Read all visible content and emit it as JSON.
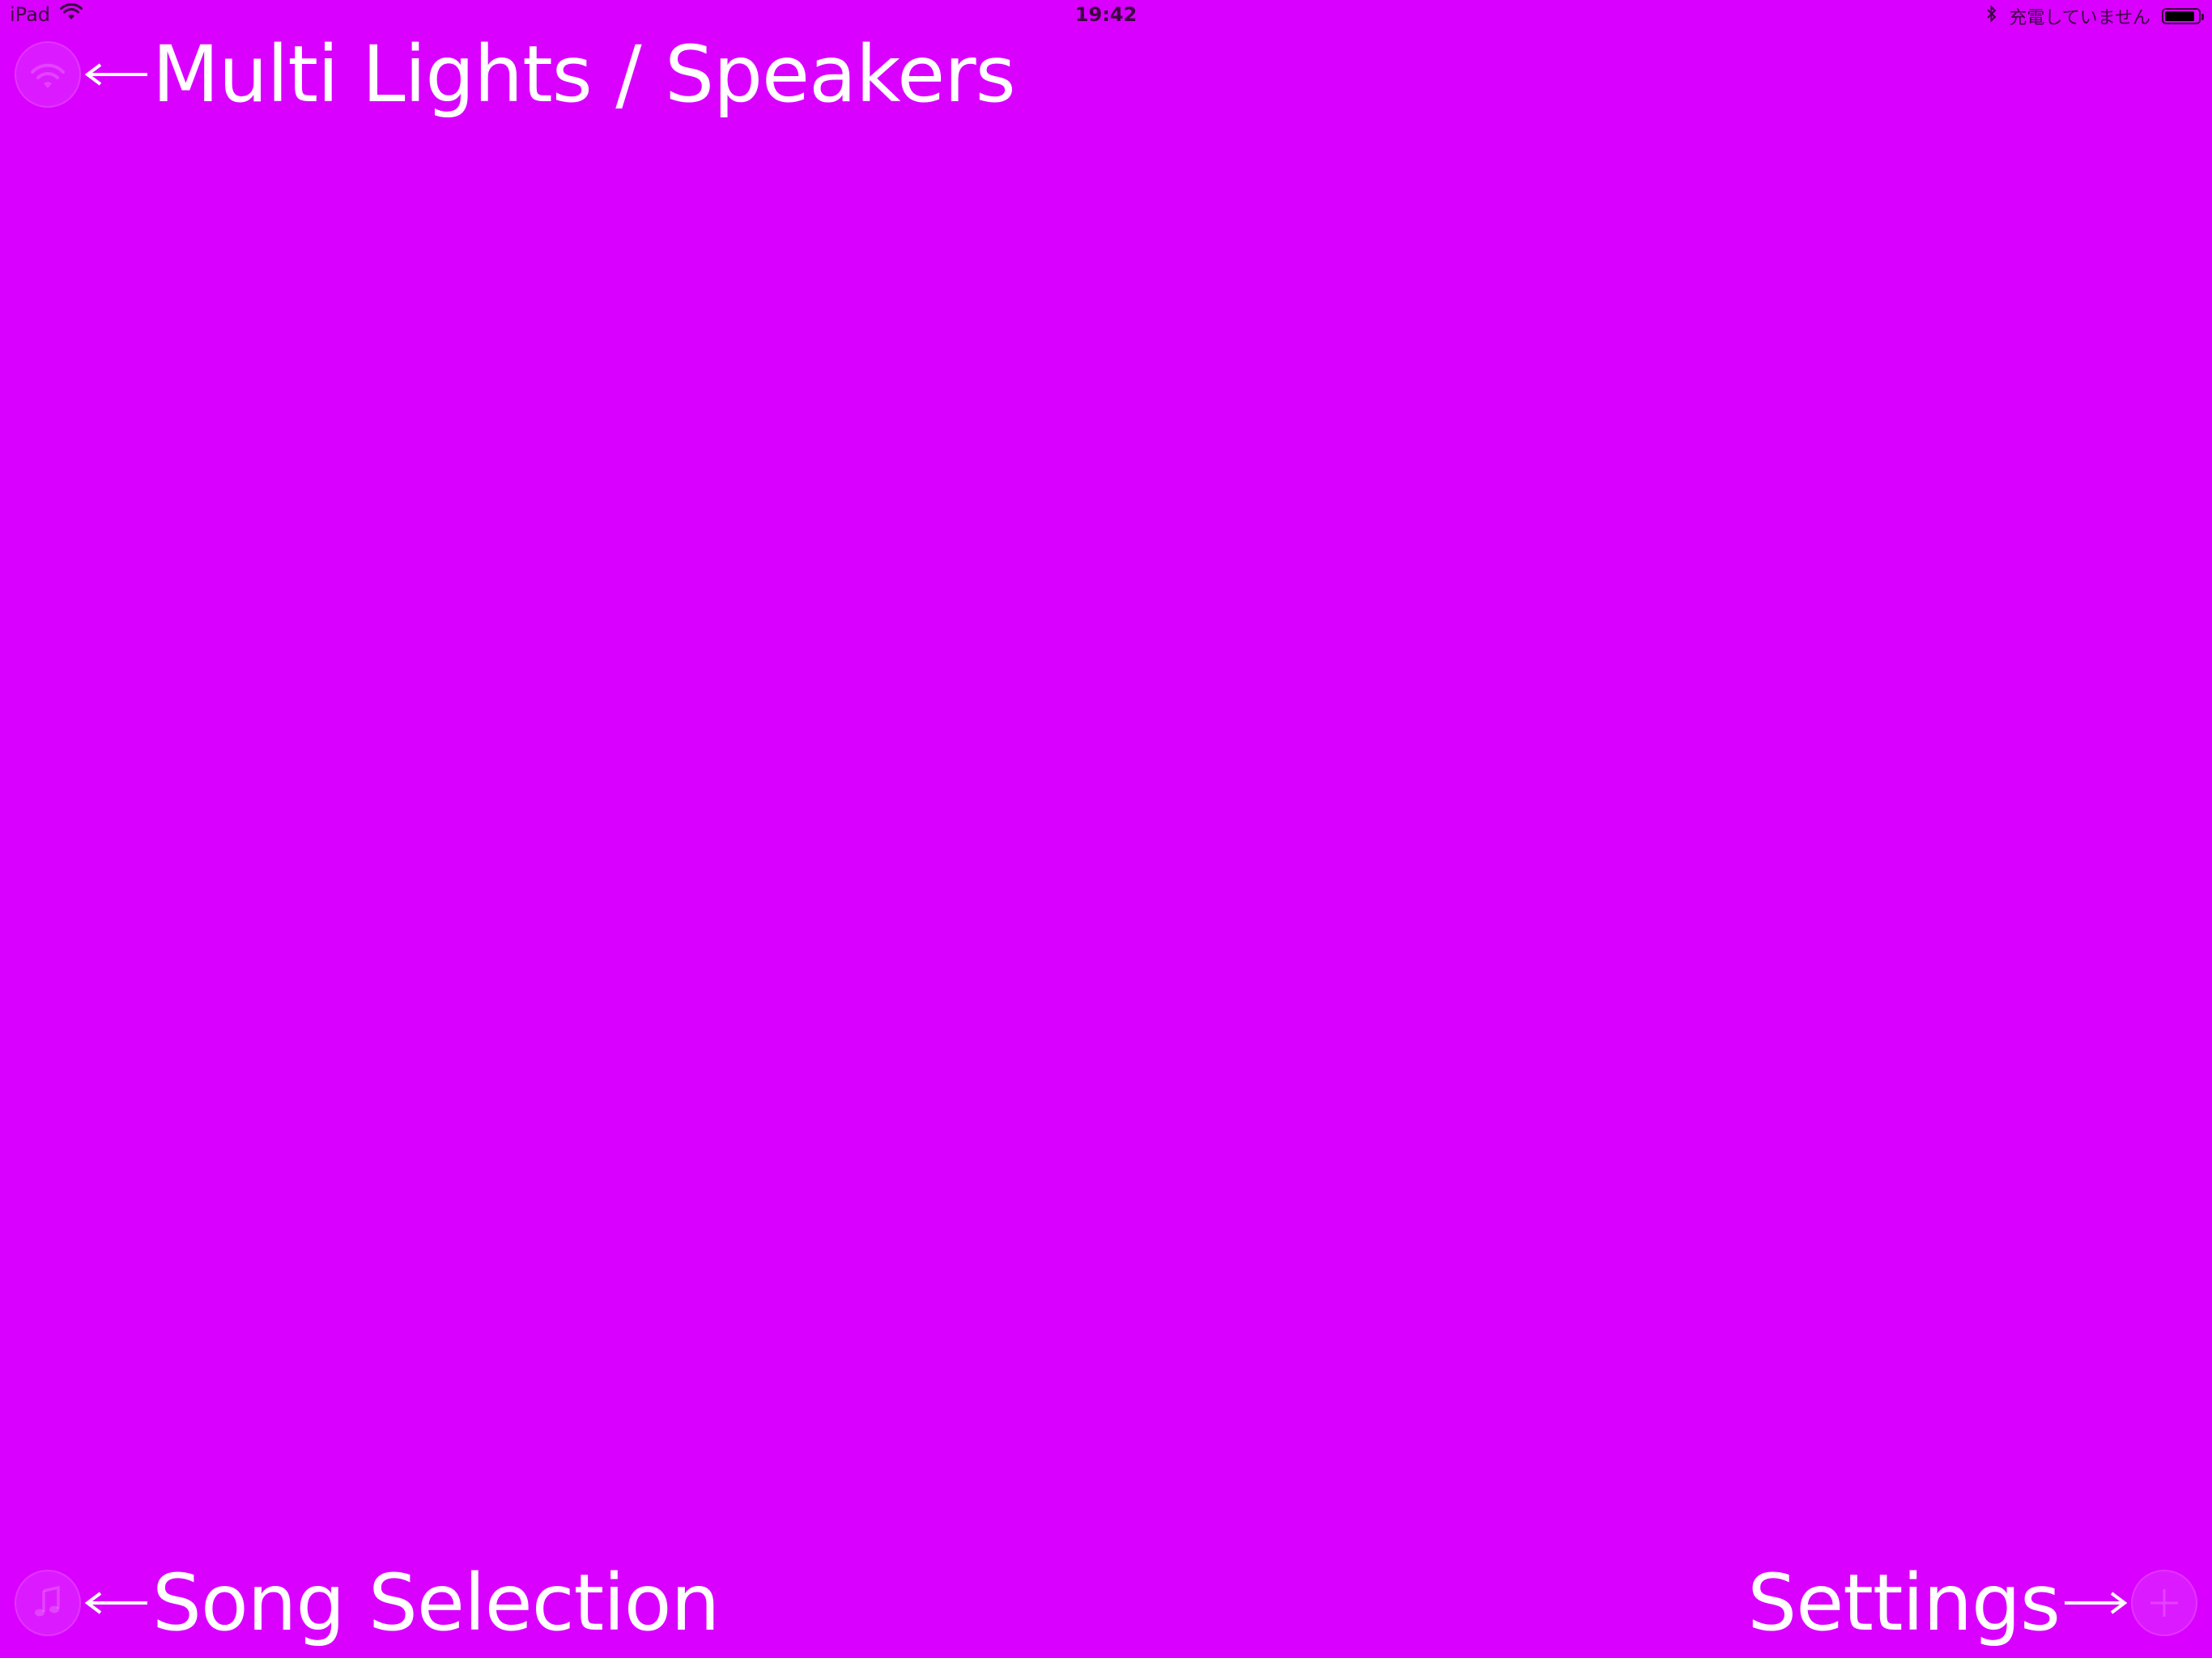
{
  "status_bar": {
    "device": "iPad",
    "time": "19:42",
    "charging_text": "充電していません",
    "battery_level": 0.9,
    "wifi_icon": "wifi-icon",
    "bluetooth_icon": "bluetooth-icon"
  },
  "hints": {
    "top_left_label": "Multi Lights / Speakers",
    "bottom_left_label": "Song Selection",
    "bottom_right_label": "Settings"
  },
  "colors": {
    "background": "#D900FF",
    "text": "#FFFFFF"
  }
}
